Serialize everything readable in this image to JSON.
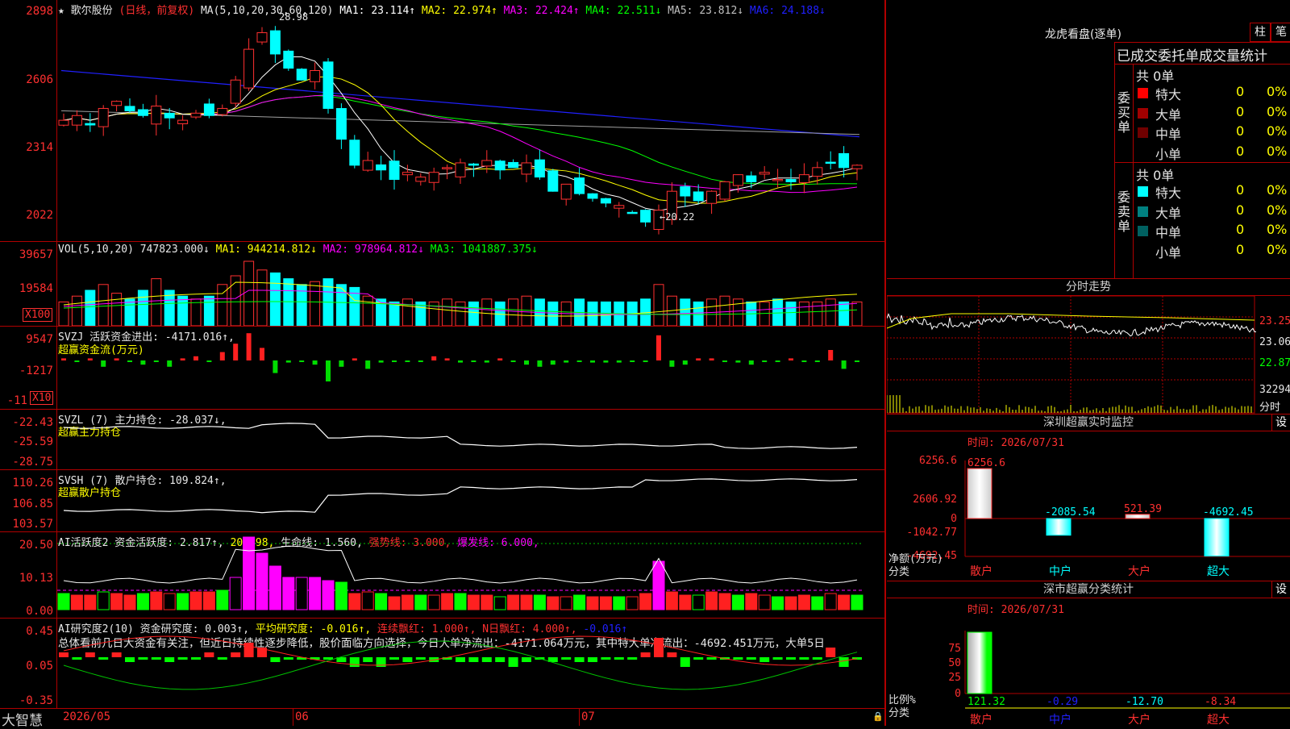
{
  "main_chart": {
    "stock_name": "歌尔股份",
    "mode": "(日线，前复权)",
    "ma_params": "MA(5,10,20,30,60,120)",
    "ma_values": [
      {
        "label": "MA1:",
        "value": "23.114↑",
        "color": "#ffffff"
      },
      {
        "label": "MA2:",
        "value": "22.974↑",
        "color": "#ffff00"
      },
      {
        "label": "MA3:",
        "value": "22.424↑",
        "color": "#ff00ff"
      },
      {
        "label": "MA4:",
        "value": "22.511↓",
        "color": "#00ff00"
      },
      {
        "label": "MA5:",
        "value": "23.812↓",
        "color": "#c0c0c0"
      },
      {
        "label": "MA6:",
        "value": "24.188↓",
        "color": "#2020ff"
      }
    ],
    "y_labels": [
      "2898",
      "2606",
      "2314",
      "2022"
    ],
    "high_marker": "28.98",
    "low_marker": "←20.22"
  },
  "vol_panel": {
    "title": "VOL(5,10,20)",
    "value": "747823.000↓",
    "ma1": "MA1: 944214.812↓",
    "ma2": "MA2: 978964.812↓",
    "ma3": "MA3: 1041887.375↓",
    "y_labels": [
      "39657",
      "19584"
    ],
    "unit": "X100"
  },
  "svzj_panel": {
    "title": "SVZJ  活跃资金进出: -4171.016↑,",
    "subtitle": "超赢资金流(万元)",
    "y_labels": [
      "9547",
      "-1217",
      "-11"
    ],
    "unit": "X10"
  },
  "svzl_panel": {
    "title": "SVZL (7) 主力持仓: -28.037↓,",
    "subtitle": "超赢主力持仓",
    "y_labels": [
      "-22.43",
      "-25.59",
      "-28.75"
    ]
  },
  "svsh_panel": {
    "title": "SVSH (7) 散户持仓: 109.824↑,",
    "subtitle": "超赢散户持仓",
    "y_labels": [
      "110.26",
      "106.85",
      "103.57"
    ]
  },
  "ai_active_panel": {
    "title": "AI活跃度2 资金活跃度: 2.817↑,",
    "v2": "20.498,",
    "v3": "生命线: 1.560,",
    "v4": "强势线: 3.000,",
    "v5": "爆发线: 6.000,",
    "y_labels": [
      "20.50",
      "10.13",
      "0.00"
    ]
  },
  "ai_research_panel": {
    "title": "AI研究度2(10) 资金研究度: 0.003↑,",
    "t2": "平均研究度: -0.016↑,",
    "t3": "连续飘红: 1.000↑,",
    "t4": "N日飘红: 4.000↑,",
    "t5": "-0.016↑",
    "analysis": "总体看前几日大资金有关注，但近日持续性逐步降低，股价面临方向选择，今日大单净流出：-4171.064万元，其中特大单净流出：-4692.451万元，大单5日",
    "y_labels": [
      "0.45",
      "0.05",
      "-0.35"
    ]
  },
  "footer": {
    "brand": "大智慧",
    "dates": [
      "2026/05",
      "06",
      "07"
    ]
  },
  "right": {
    "lhb_title": "龙虎看盘(逐单)",
    "btn_bar": "柱",
    "btn_pen": "笔",
    "table_header": "已成交委托单成交量统计",
    "buy_side": "委买单",
    "sell_side": "委卖单",
    "buy_total": "共 0单",
    "sell_total": "共 0单",
    "buy_rows": [
      {
        "label": "特大",
        "count": "0",
        "pct": "0%",
        "color": "#ff0000"
      },
      {
        "label": "大单",
        "count": "0",
        "pct": "0%",
        "color": "#a00000"
      },
      {
        "label": "中单",
        "count": "0",
        "pct": "0%",
        "color": "#700000"
      },
      {
        "label": "小单",
        "count": "0",
        "pct": "0%",
        "color": ""
      }
    ],
    "sell_rows": [
      {
        "label": "特大",
        "count": "0",
        "pct": "0%",
        "color": "#00ffff"
      },
      {
        "label": "大单",
        "count": "0",
        "pct": "0%",
        "color": "#008080"
      },
      {
        "label": "中单",
        "count": "0",
        "pct": "0%",
        "color": "#006060"
      },
      {
        "label": "小单",
        "count": "0",
        "pct": "0%",
        "color": ""
      }
    ],
    "intraday_title": "分时走势",
    "intraday_prices": [
      "23.25",
      "23.06",
      "22.87"
    ],
    "intraday_vol": "32294",
    "intraday_unit": "分时",
    "monitor_title": "深圳超赢实时监控",
    "monitor_btn": "设",
    "monitor_time": "时间: 2026/07/31",
    "monitor_y": [
      "6256.6",
      "2606.92",
      "0",
      "-1042.77",
      "-4692.45"
    ],
    "monitor_values": [
      "6256.6",
      "-2085.54",
      "521.39",
      "-4692.45"
    ],
    "monitor_unit": "净额(万元)",
    "monitor_cat_label": "分类",
    "categories": [
      "散户",
      "中户",
      "大户",
      "超大"
    ],
    "class_title": "深市超赢分类统计",
    "class_btn": "设",
    "class_time": "时间: 2026/07/31",
    "class_y": [
      "75",
      "50",
      "25",
      "0"
    ],
    "class_values": [
      "121.32",
      "-0.29",
      "-12.70",
      "-8.34"
    ],
    "class_unit": "比例%",
    "class_cat_label": "分类"
  }
}
